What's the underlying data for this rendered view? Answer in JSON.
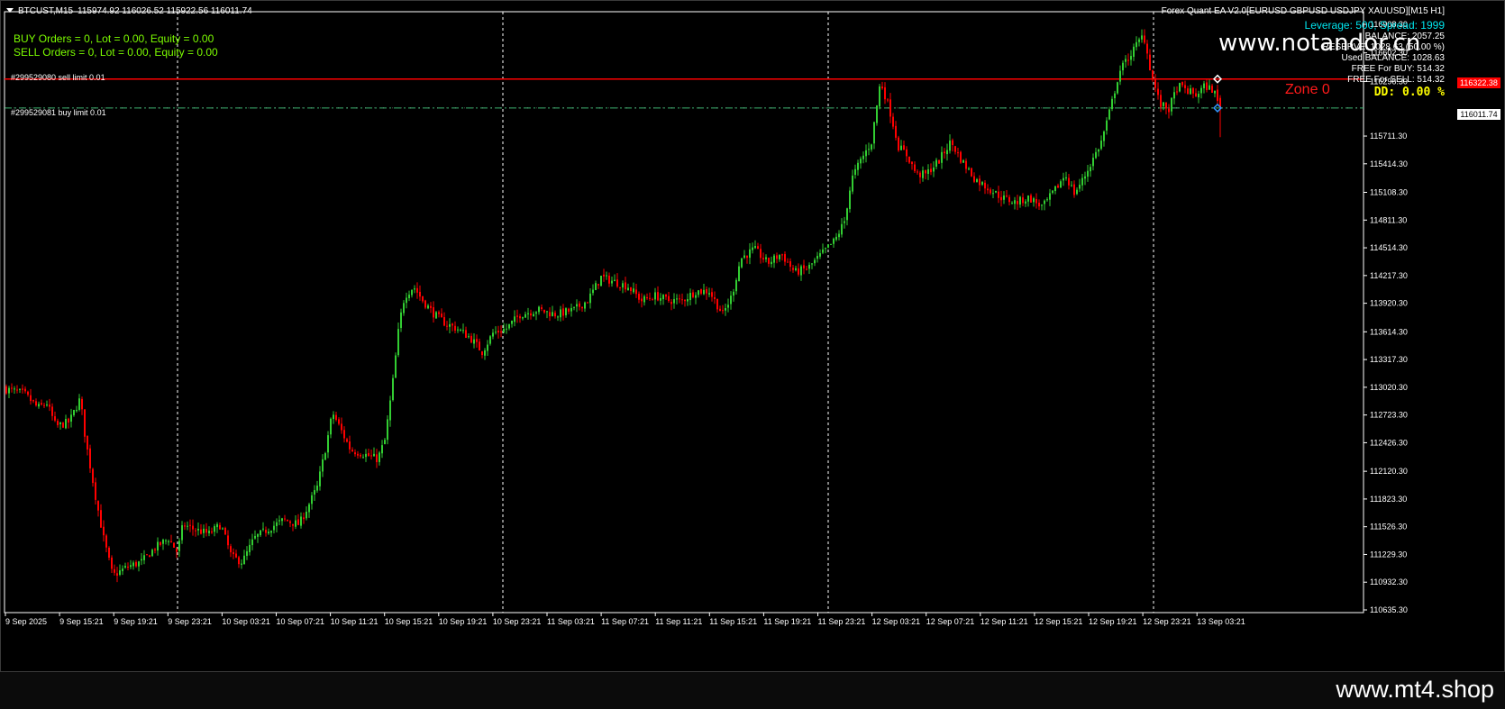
{
  "header": {
    "symbol": "BTCUST,M15",
    "ohlc": "115974.92 116026.52 115922.56 116011.74"
  },
  "indicators": {
    "buy_line": "BUY Orders = 0,  Lot = 0.00,  Equity = 0.00",
    "sell_line": "SELL Orders = 0,  Lot = 0.00,  Equity = 0.00"
  },
  "ea_panel": {
    "title": "Forex Quant EA  V2.0[EURUSD GBPUSD USDJPY XAUUSD][M15 H1]",
    "leverage": "Leverage: 500, Spread: 1999",
    "balance": "BALANCE: 2057.25",
    "reserve": "RESERVE: 1028.63 (50.00 %)",
    "used_balance": "Used BALANCE: 1028.63",
    "free_buy": "FREE For BUY: 514.32",
    "free_sell": "FREE For SELL: 514.32",
    "dd": "DD:  0.00 %"
  },
  "orders": {
    "sell_limit": "#299529080 sell limit 0.01",
    "buy_limit": "#299529081 buy limit 0.01"
  },
  "zone_label": "Zone 0",
  "watermark_top": "www.notandor.cn",
  "watermark_bottom": "www.mt4.shop",
  "price_tags": {
    "sell_limit_price": "116322.38",
    "current_price": "116011.74"
  },
  "colors": {
    "background": "#000000",
    "bull": "#32cd32",
    "bear": "#ff0000",
    "grid": "#ffffff",
    "sell_line": "#ff0000",
    "buy_line": "#3cb371",
    "text_green": "#7cfc00",
    "leverage_text": "#00e5ee",
    "dd_text": "#ffff00"
  },
  "chart_data": {
    "type": "candlestick",
    "ylim": [
      110635.3,
      117050
    ],
    "y_ticks": [
      "116908.30",
      "116602.30",
      "116296.30",
      "116011.74",
      "115711.30",
      "115414.30",
      "115108.30",
      "114811.30",
      "114514.30",
      "114217.30",
      "113920.30",
      "113614.30",
      "113317.30",
      "113020.30",
      "112723.30",
      "112426.30",
      "112120.30",
      "111823.30",
      "111526.30",
      "111229.30",
      "110932.30",
      "110635.30"
    ],
    "x_ticks": [
      "9 Sep 2025",
      "9 Sep 15:21",
      "9 Sep 19:21",
      "9 Sep 23:21",
      "10 Sep 03:21",
      "10 Sep 07:21",
      "10 Sep 11:21",
      "10 Sep 15:21",
      "10 Sep 19:21",
      "10 Sep 23:21",
      "11 Sep 03:21",
      "11 Sep 07:21",
      "11 Sep 11:21",
      "11 Sep 15:21",
      "11 Sep 19:21",
      "11 Sep 23:21",
      "12 Sep 03:21",
      "12 Sep 07:21",
      "12 Sep 11:21",
      "12 Sep 15:21",
      "12 Sep 19:21",
      "12 Sep 23:21",
      "13 Sep 03:21"
    ],
    "sell_limit_price": 116322.38,
    "buy_limit_price": 116011.74,
    "last_close": 116011.74,
    "close_path": [
      [
        0,
        113000
      ],
      [
        20,
        112950
      ],
      [
        35,
        112800
      ],
      [
        45,
        112850
      ],
      [
        55,
        112600
      ],
      [
        70,
        112650
      ],
      [
        82,
        112900
      ],
      [
        88,
        112450
      ],
      [
        100,
        111800
      ],
      [
        108,
        111400
      ],
      [
        118,
        111000
      ],
      [
        135,
        111100
      ],
      [
        150,
        111150
      ],
      [
        165,
        111300
      ],
      [
        180,
        111400
      ],
      [
        190,
        111250
      ],
      [
        196,
        111550
      ],
      [
        208,
        111500
      ],
      [
        225,
        111450
      ],
      [
        238,
        111550
      ],
      [
        250,
        111200
      ],
      [
        262,
        111150
      ],
      [
        275,
        111400
      ],
      [
        290,
        111500
      ],
      [
        308,
        111600
      ],
      [
        325,
        111550
      ],
      [
        335,
        111750
      ],
      [
        345,
        111950
      ],
      [
        355,
        112400
      ],
      [
        362,
        112750
      ],
      [
        372,
        112550
      ],
      [
        382,
        112350
      ],
      [
        398,
        112300
      ],
      [
        412,
        112250
      ],
      [
        420,
        112450
      ],
      [
        428,
        113000
      ],
      [
        436,
        113700
      ],
      [
        442,
        114000
      ],
      [
        452,
        114100
      ],
      [
        462,
        113950
      ],
      [
        475,
        113800
      ],
      [
        488,
        113700
      ],
      [
        500,
        113650
      ],
      [
        515,
        113550
      ],
      [
        528,
        113400
      ],
      [
        540,
        113600
      ],
      [
        555,
        113650
      ],
      [
        570,
        113800
      ],
      [
        590,
        113850
      ],
      [
        610,
        113800
      ],
      [
        630,
        113850
      ],
      [
        645,
        113950
      ],
      [
        660,
        114200
      ],
      [
        675,
        114150
      ],
      [
        690,
        114100
      ],
      [
        705,
        113950
      ],
      [
        720,
        114000
      ],
      [
        735,
        113950
      ],
      [
        750,
        113950
      ],
      [
        765,
        114050
      ],
      [
        780,
        114050
      ],
      [
        795,
        113800
      ],
      [
        805,
        114000
      ],
      [
        815,
        114400
      ],
      [
        830,
        114500
      ],
      [
        845,
        114350
      ],
      [
        860,
        114450
      ],
      [
        875,
        114250
      ],
      [
        890,
        114300
      ],
      [
        905,
        114450
      ],
      [
        920,
        114600
      ],
      [
        930,
        114800
      ],
      [
        938,
        115250
      ],
      [
        948,
        115450
      ],
      [
        960,
        115650
      ],
      [
        970,
        116300
      ],
      [
        980,
        116000
      ],
      [
        990,
        115600
      ],
      [
        1000,
        115500
      ],
      [
        1010,
        115300
      ],
      [
        1020,
        115300
      ],
      [
        1035,
        115450
      ],
      [
        1048,
        115650
      ],
      [
        1060,
        115450
      ],
      [
        1075,
        115250
      ],
      [
        1090,
        115150
      ],
      [
        1105,
        115050
      ],
      [
        1120,
        115000
      ],
      [
        1135,
        115050
      ],
      [
        1150,
        114950
      ],
      [
        1165,
        115150
      ],
      [
        1175,
        115300
      ],
      [
        1185,
        115100
      ],
      [
        1195,
        115250
      ],
      [
        1205,
        115450
      ],
      [
        1215,
        115650
      ],
      [
        1225,
        116000
      ],
      [
        1235,
        116400
      ],
      [
        1245,
        116550
      ],
      [
        1255,
        116700
      ],
      [
        1262,
        116800
      ],
      [
        1270,
        116400
      ],
      [
        1280,
        116050
      ],
      [
        1290,
        116000
      ],
      [
        1300,
        116250
      ],
      [
        1310,
        116200
      ],
      [
        1320,
        116150
      ],
      [
        1330,
        116250
      ],
      [
        1340,
        116200
      ],
      [
        1346,
        116011.74
      ]
    ]
  }
}
